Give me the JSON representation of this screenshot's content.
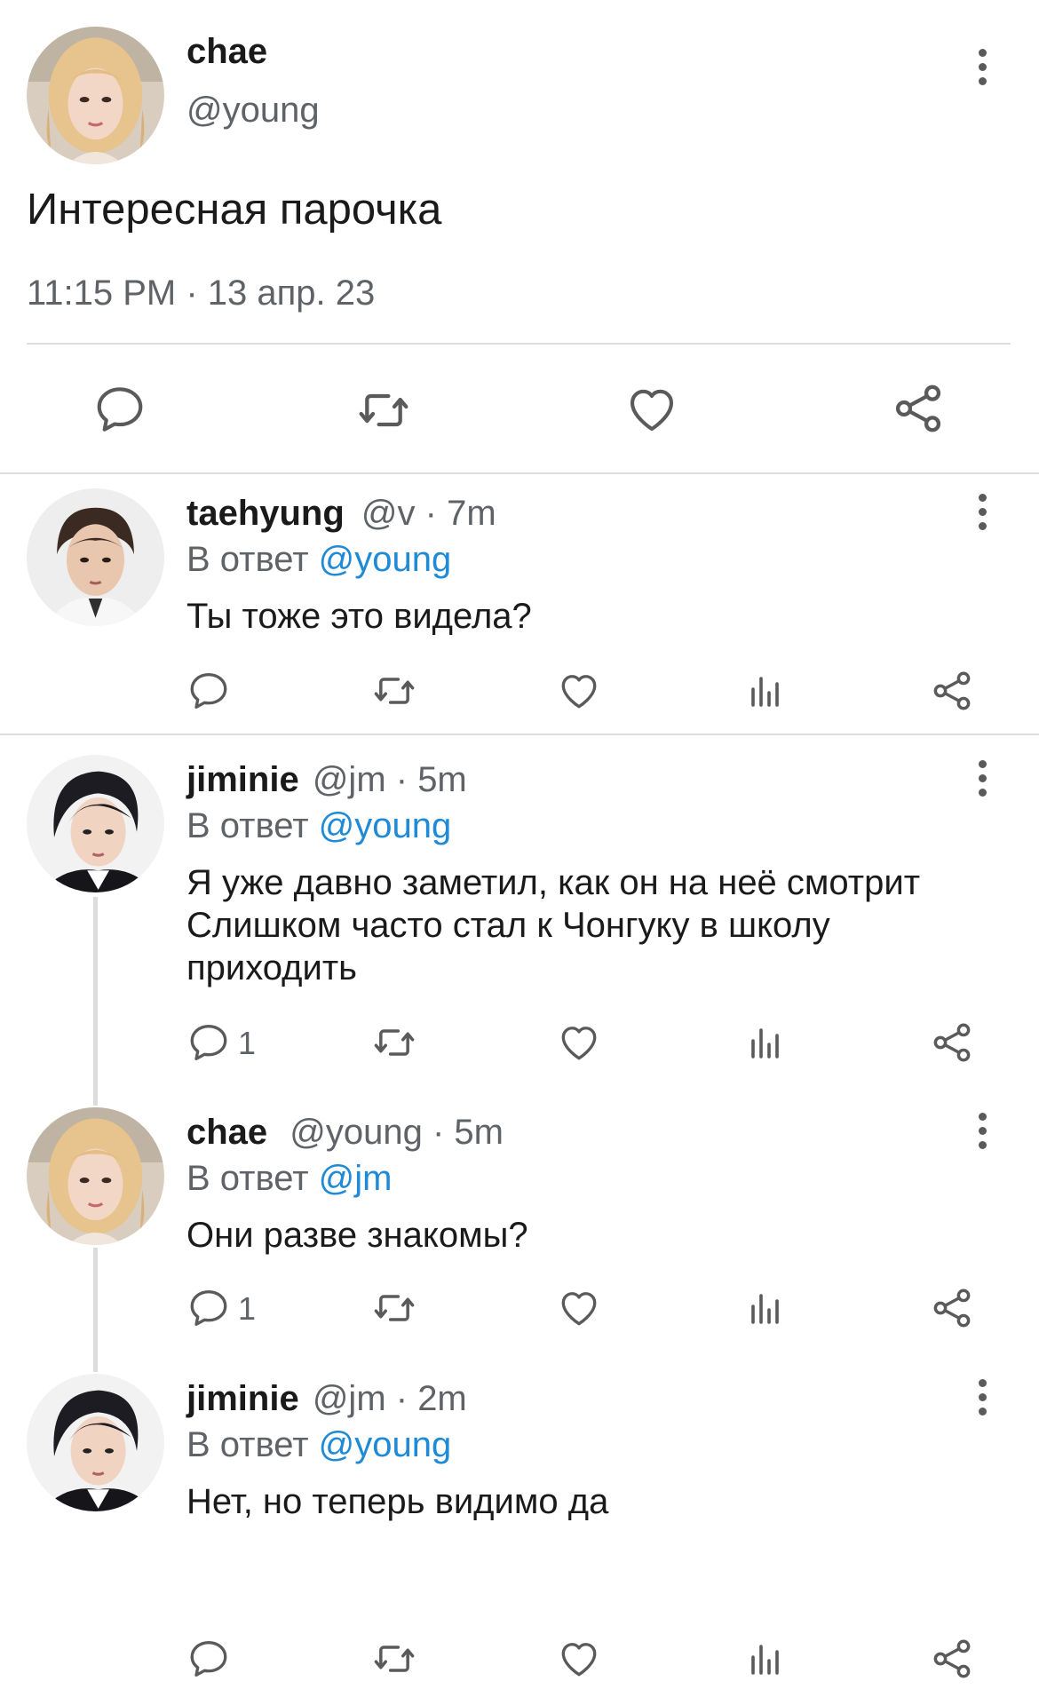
{
  "main_tweet": {
    "name": "chae",
    "handle": "@young",
    "text": "Интересная парочка",
    "timestamp": "11:15 PM · 13 апр. 23"
  },
  "replies": [
    {
      "name": "taehyung",
      "meta": "@v · 7m",
      "reply_prefix": "В ответ",
      "reply_to": "@young",
      "lines": [
        "Ты тоже это видела?"
      ],
      "reply_count": ""
    },
    {
      "name": "jiminie",
      "meta": "@jm · 5m",
      "reply_prefix": "В ответ",
      "reply_to": "@young",
      "lines": [
        "Я уже давно заметил, как он на неё смотрит",
        "Слишком часто стал к Чонгуку в школу",
        "приходить"
      ],
      "reply_count": "1"
    },
    {
      "name": "chae",
      "meta": "@young · 5m",
      "reply_prefix": "В ответ",
      "reply_to": "@jm",
      "lines": [
        "Они разве знакомы?"
      ],
      "reply_count": "1"
    },
    {
      "name": "jiminie",
      "meta": "@jm · 2m",
      "reply_prefix": "В ответ",
      "reply_to": "@young",
      "lines": [
        "Нет, но теперь видимо да"
      ],
      "reply_count": ""
    }
  ],
  "icons": {
    "reply": "comment-icon",
    "retweet": "retweet-icon",
    "like": "heart-icon",
    "stats": "stats-icon",
    "share": "share-icon",
    "more": "more-vertical-icon"
  },
  "colors": {
    "link": "#1f8ad6",
    "secondary_text": "#5f6368",
    "divider": "#dedede"
  }
}
